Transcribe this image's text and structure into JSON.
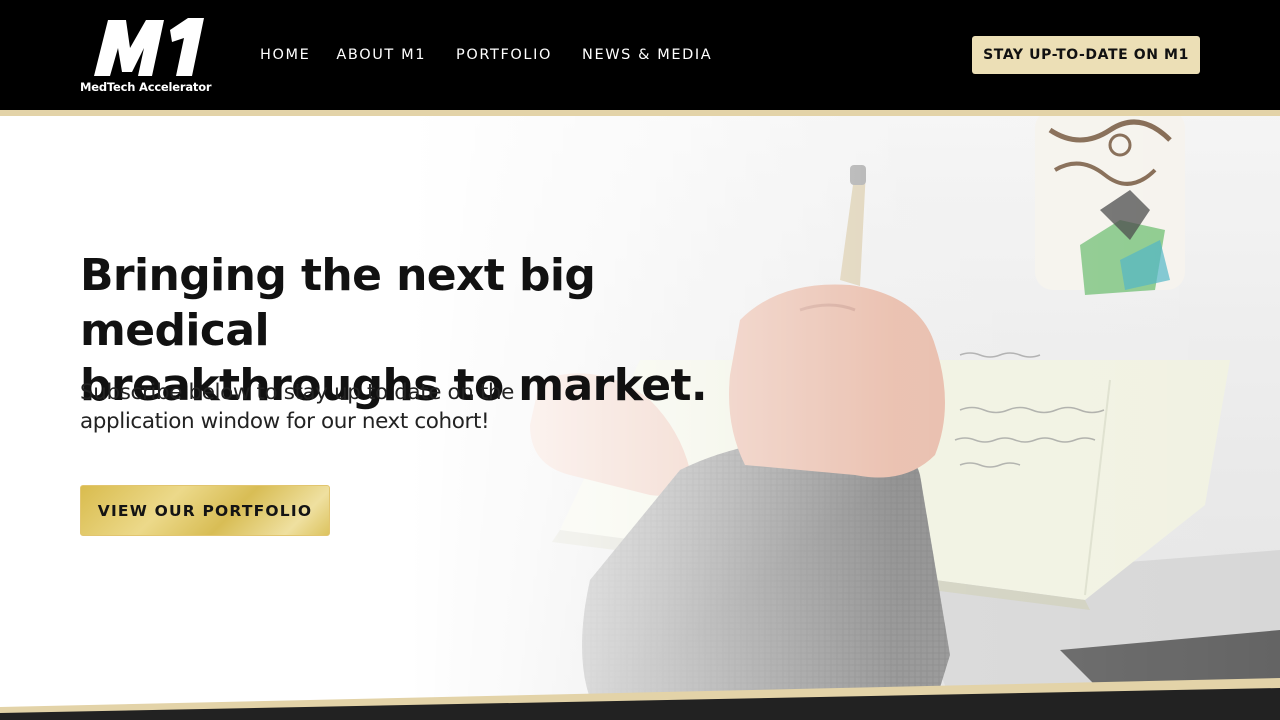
{
  "header": {
    "logo_mark": "M1",
    "logo_sub": "MedTech Accelerator",
    "nav": [
      {
        "label": "HOME"
      },
      {
        "label": "ABOUT M1"
      },
      {
        "label": "PORTFOLIO"
      },
      {
        "label": "NEWS & MEDIA"
      }
    ],
    "cta_label": "STAY UP-TO-DATE ON M1"
  },
  "hero": {
    "headline_line1": "Bringing the next big medical",
    "headline_line2": "breakthroughs to market.",
    "sub_line1": "Subscribe below to stay up to date on the",
    "sub_line2": "application window for our next cohort!",
    "button_label": "VIEW OUR PORTFOLIO"
  },
  "colors": {
    "header_bg": "#000000",
    "cta_bg": "#ecdfb6",
    "gold_button": "#dcc35f",
    "accent_stripe": "#e3d3a8",
    "text_dark": "#111111"
  }
}
